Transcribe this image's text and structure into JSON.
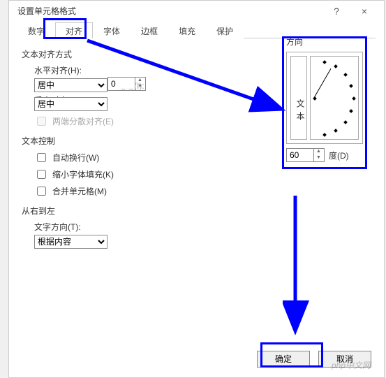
{
  "dialog": {
    "title": "设置单元格格式",
    "help": "?",
    "close": "×"
  },
  "tabs": {
    "items": [
      "数字",
      "对齐",
      "字体",
      "边框",
      "填充",
      "保护"
    ],
    "active_index": 1
  },
  "alignment": {
    "section_title": "文本对齐方式",
    "h_label": "水平对齐(H):",
    "h_value": "居中",
    "indent_label": "缩进(I):",
    "indent_value": "0",
    "v_label": "垂直对齐(V):",
    "v_value": "居中",
    "justify_distributed": "两端分散对齐(E)"
  },
  "text_control": {
    "section_title": "文本控制",
    "wrap": "自动换行(W)",
    "shrink": "缩小字体填充(K)",
    "merge": "合并单元格(M)"
  },
  "rtl": {
    "section_title": "从右到左",
    "dir_label": "文字方向(T):",
    "dir_value": "根据内容"
  },
  "orientation": {
    "title": "方向",
    "vertical_text": "文本",
    "degrees_value": "60",
    "degrees_label": "度(D)"
  },
  "buttons": {
    "ok": "确定",
    "cancel": "取消"
  },
  "watermark": "php中文网",
  "chart_data": {
    "type": "dial",
    "title": "方向",
    "value": 60,
    "unit": "度",
    "range": [
      -90,
      90
    ]
  }
}
